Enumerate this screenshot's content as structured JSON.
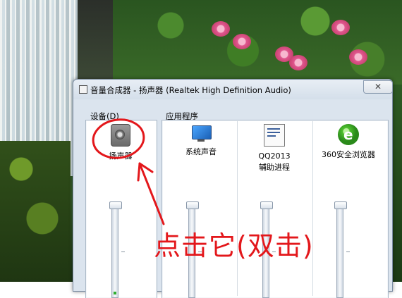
{
  "window": {
    "title": "音量合成器 - 扬声器 (Realtek High Definition Audio)",
    "close_label": "✕"
  },
  "groups": {
    "device_label_before": "设备(",
    "device_label_accel": "D",
    "device_label_after": ")",
    "apps_label": "应用程序"
  },
  "channels": [
    {
      "name": "扬声器",
      "icon": "speaker-icon",
      "volume": 1.0
    },
    {
      "name": "系统声音",
      "icon": "system-sounds-icon",
      "volume": 1.0
    },
    {
      "name_line1": "QQ2013",
      "name_line2": "辅助进程",
      "icon": "qq-helper-icon",
      "volume": 1.0
    },
    {
      "name": "360安全浏览器",
      "icon": "browser-360-icon",
      "volume": 1.0
    }
  ],
  "annotation": {
    "text": "点击它(双击)",
    "color": "#e3171b"
  }
}
